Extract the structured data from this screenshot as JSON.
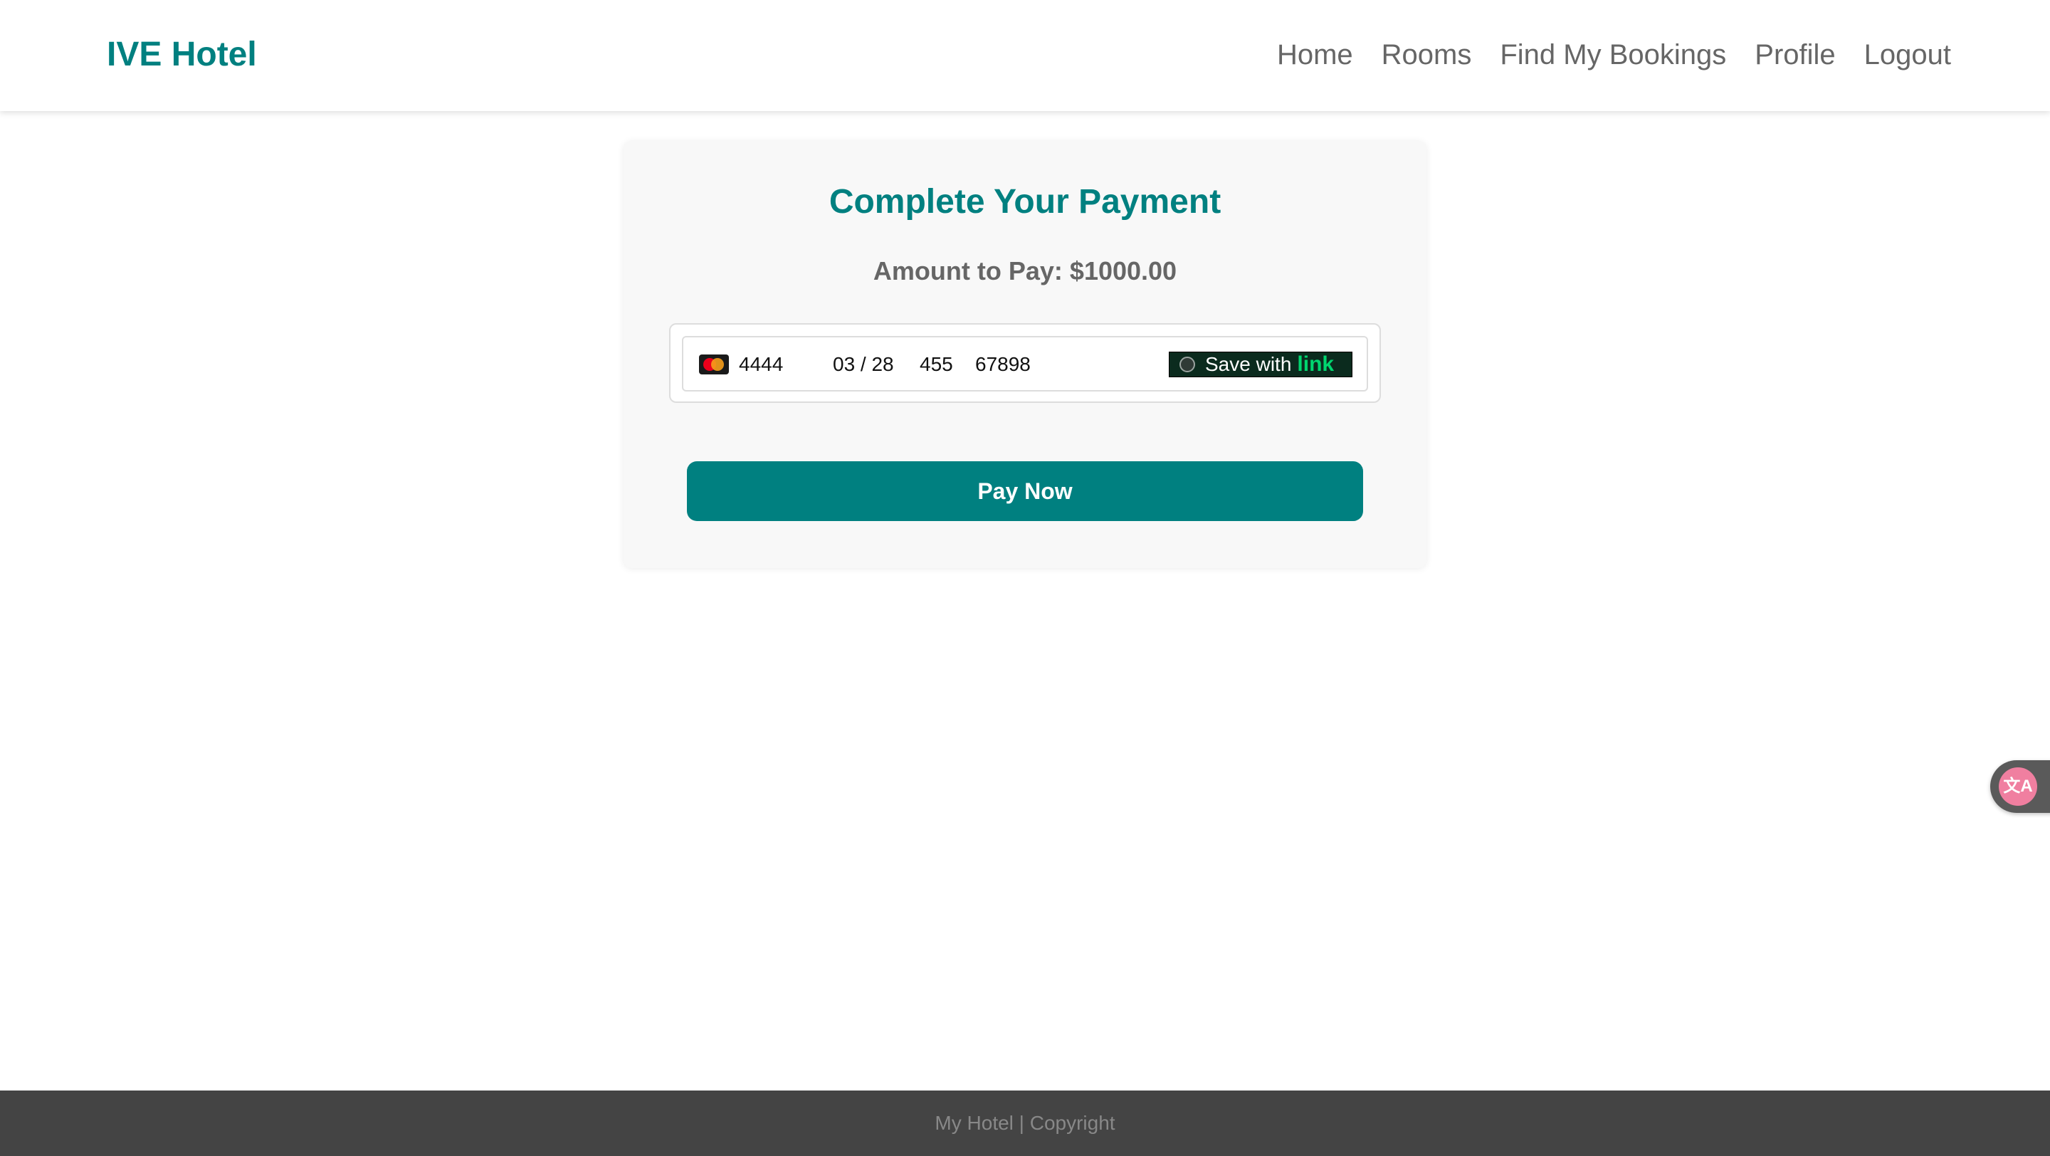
{
  "header": {
    "brand": "IVE Hotel",
    "nav": [
      {
        "label": "Home"
      },
      {
        "label": "Rooms"
      },
      {
        "label": "Find My Bookings"
      },
      {
        "label": "Profile"
      },
      {
        "label": "Logout"
      }
    ]
  },
  "payment": {
    "title": "Complete Your Payment",
    "amount_label": "Amount to Pay:",
    "amount_value": "$1000.00",
    "card": {
      "brand_icon": "mastercard-icon",
      "number": "4444",
      "expiry": "03 / 28",
      "cvc": "455",
      "zip": "67898",
      "save_label": "Save with",
      "link_word": "link"
    },
    "pay_button": "Pay Now"
  },
  "widget": {
    "icon": "translate-icon",
    "glyph": "文A"
  },
  "footer": {
    "text": "My Hotel | Copyright"
  },
  "colors": {
    "brand": "#008080",
    "muted_text": "#666666",
    "footer_bg": "#444444",
    "link_green": "#00d66f"
  }
}
